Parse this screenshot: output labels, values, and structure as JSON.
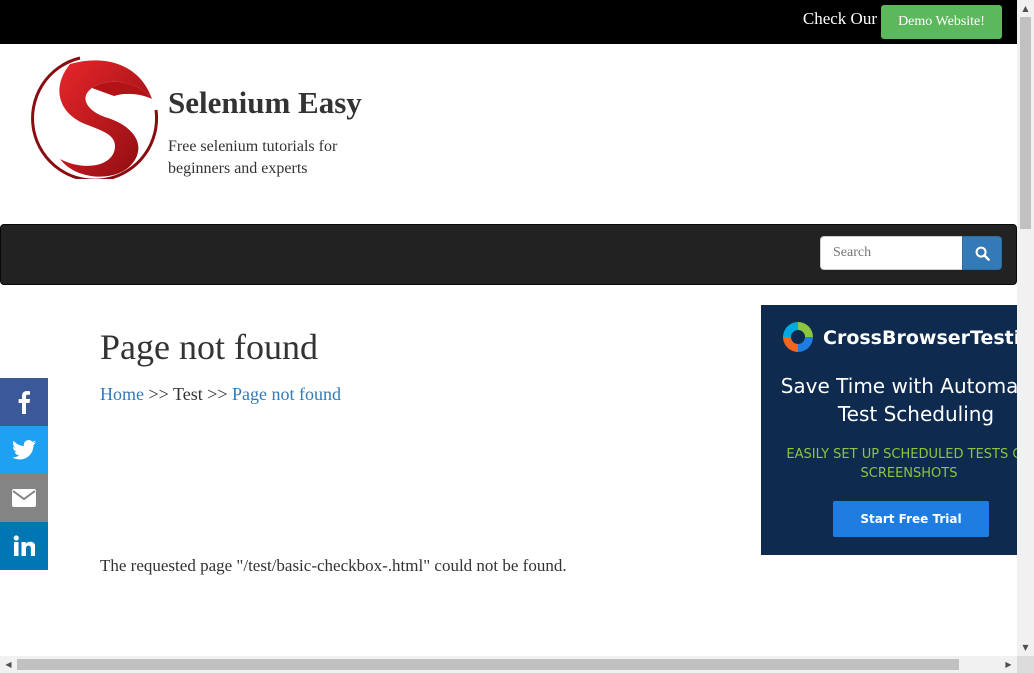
{
  "topbar": {
    "check_text": "Check Our",
    "demo_button": "Demo Website!"
  },
  "header": {
    "site_title": "Selenium Easy",
    "site_description": "Free selenium tutorials for beginners and experts"
  },
  "navbar": {
    "search_placeholder": "Search",
    "search_icon": "search-icon"
  },
  "main": {
    "page_title": "Page not found",
    "breadcrumb": {
      "home": "Home",
      "sep1": ">>",
      "test": "Test",
      "sep2": ">>",
      "current": "Page not found"
    },
    "message": "The requested page \"/test/basic-checkbox-.html\" could not be found."
  },
  "social": {
    "items": [
      "facebook-icon",
      "twitter-icon",
      "email-icon",
      "linkedin-icon"
    ]
  },
  "ad": {
    "brand": "CrossBrowserTesting",
    "headline": "Save Time with Automated Test Scheduling",
    "subline": "EASILY SET UP SCHEDULED TESTS OR SCREENSHOTS",
    "cta": "Start Free Trial"
  },
  "colors": {
    "topbar": "#000000",
    "demo_button": "#5cb85c",
    "navbar": "#222222",
    "link": "#337ab7",
    "facebook": "#3b5998",
    "twitter": "#1da1f2",
    "email": "#848484",
    "linkedin": "#0077b5",
    "ad_background": "#0e2a4f",
    "ad_accent": "#8cc63f"
  }
}
